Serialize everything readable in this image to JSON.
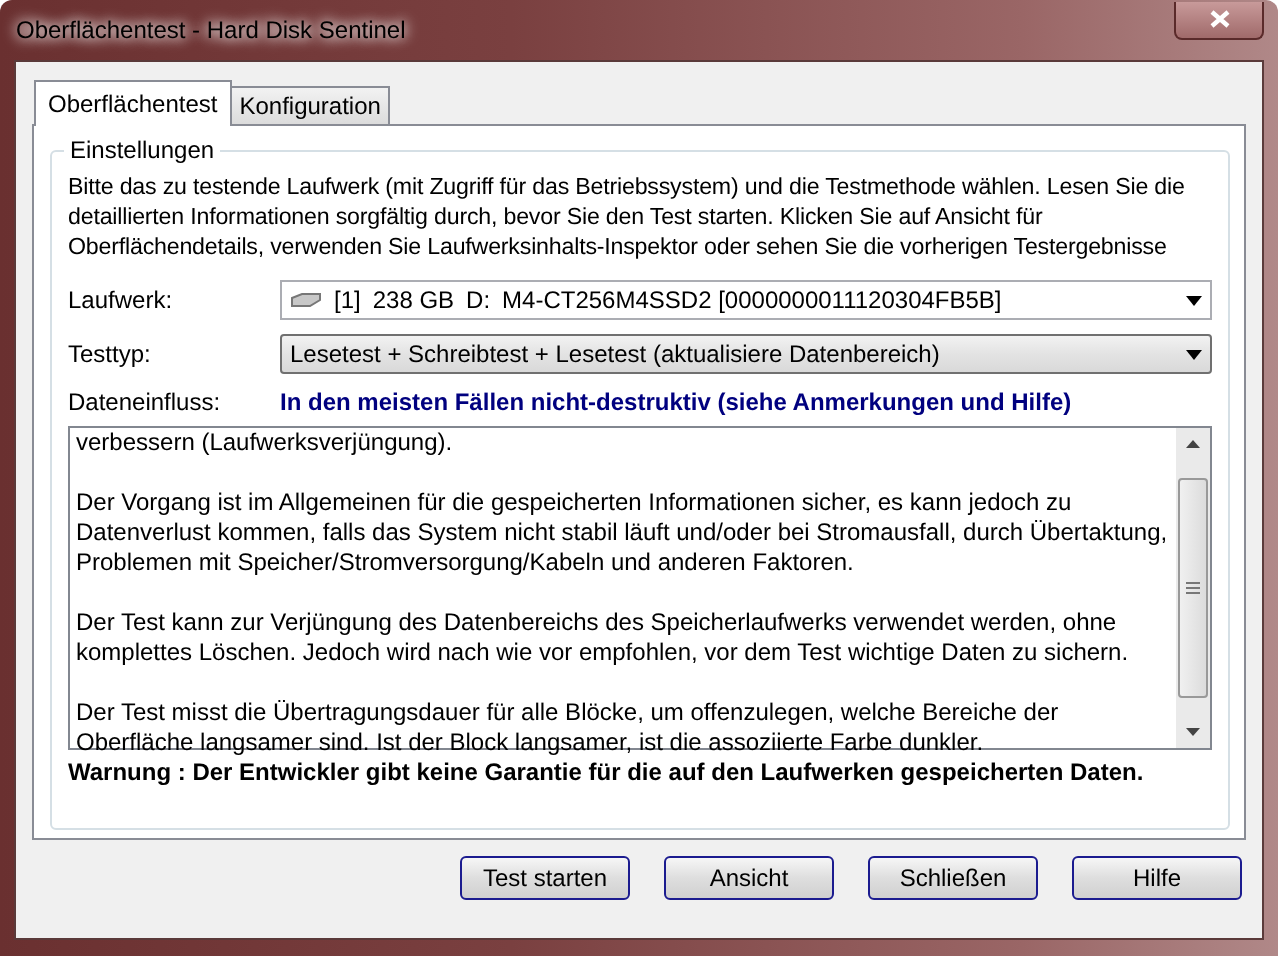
{
  "window": {
    "title": "Oberflächentest - Hard Disk Sentinel"
  },
  "tabs": [
    {
      "label": "Oberflächentest",
      "selected": true
    },
    {
      "label": "Konfiguration",
      "selected": false
    }
  ],
  "group": {
    "title": "Einstellungen",
    "intro": "Bitte das zu testende Laufwerk (mit Zugriff für das Betriebssystem) und die Testmethode wählen. Lesen Sie die detaillierten Informationen sorgfältig durch, bevor Sie den Test starten. Klicken Sie auf Ansicht für Oberflächendetails, verwenden Sie Laufwerksinhalts-Inspektor oder sehen Sie die vorherigen Testergebnisse",
    "drive": {
      "label": "Laufwerk:",
      "index": "[1]",
      "size": "238 GB",
      "letter": "D:",
      "model": "M4-CT256M4SSD2 [0000000011120304FB5B]"
    },
    "test_type": {
      "label": "Testtyp:",
      "value": "Lesetest + Schreibtest + Lesetest (aktualisiere Datenbereich)"
    },
    "data_impact": {
      "label": "Dateneinfluss:",
      "value": "In den meisten Fällen nicht-destruktiv (siehe Anmerkungen und Hilfe)"
    },
    "description": [
      "verbessern (Laufwerksverjüngung).",
      "Der Vorgang ist im Allgemeinen für die gespeicherten Informationen sicher, es kann jedoch zu Datenverlust kommen, falls das System nicht stabil läuft und/oder bei Stromausfall, durch Übertaktung, Problemen mit Speicher/Stromversorgung/Kabeln und anderen Faktoren.",
      "Der Test kann zur Verjüngung des Datenbereichs des Speicherlaufwerks verwendet werden, ohne komplettes Löschen. Jedoch wird nach wie vor empfohlen, vor dem Test wichtige Daten zu sichern.",
      "Der Test misst die Übertragungsdauer für alle Blöcke, um offenzulegen, welche Bereiche der Oberfläche langsamer sind. Ist der Block langsamer, ist die assoziierte Farbe dunkler."
    ],
    "warning": "Warnung : Der Entwickler gibt keine Garantie für die auf den Laufwerken gespeicherten Daten."
  },
  "buttons": [
    "Test starten",
    "Ansicht",
    "Schließen",
    "Hilfe"
  ]
}
